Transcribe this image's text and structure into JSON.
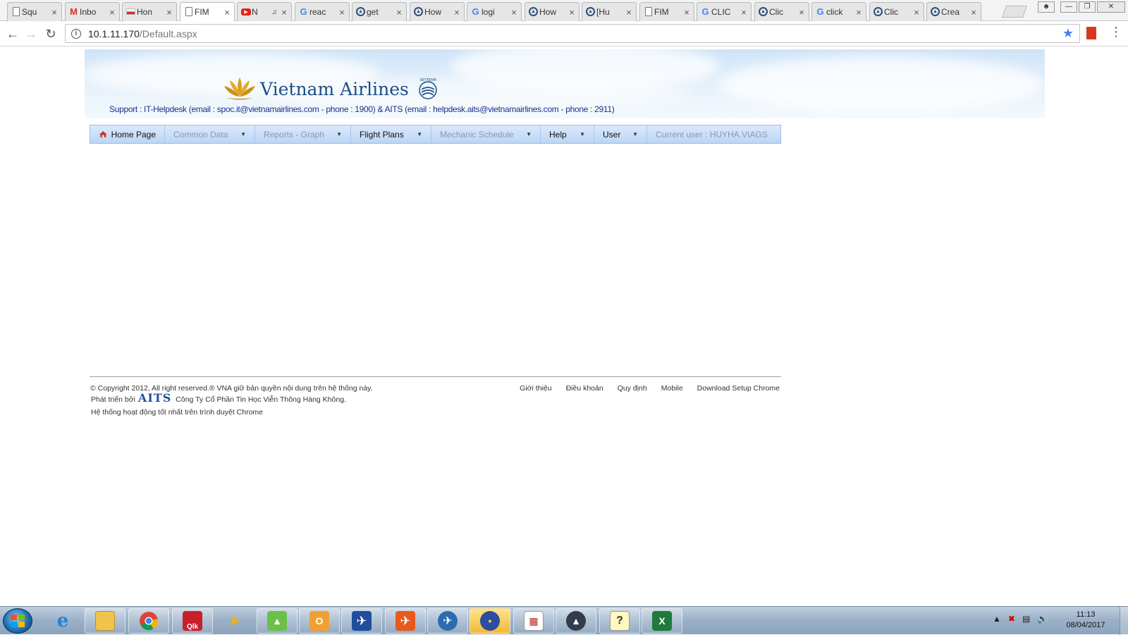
{
  "tabs": [
    {
      "title": "Squ",
      "favicon": "doc"
    },
    {
      "title": "Inbo",
      "favicon": "gmail"
    },
    {
      "title": "Hon",
      "favicon": "flag"
    },
    {
      "title": "FIM",
      "favicon": "doc",
      "active": true
    },
    {
      "title": "N",
      "favicon": "youtube",
      "audio": true
    },
    {
      "title": "reac",
      "favicon": "google"
    },
    {
      "title": "get",
      "favicon": "circle"
    },
    {
      "title": "How",
      "favicon": "circle"
    },
    {
      "title": "logi",
      "favicon": "google"
    },
    {
      "title": "How",
      "favicon": "circle"
    },
    {
      "title": "[Hu",
      "favicon": "circle"
    },
    {
      "title": "FIM",
      "favicon": "doc"
    },
    {
      "title": "CLIC",
      "favicon": "google"
    },
    {
      "title": "Clic",
      "favicon": "circle"
    },
    {
      "title": "click",
      "favicon": "google"
    },
    {
      "title": "Clic",
      "favicon": "circle"
    },
    {
      "title": "Crea",
      "favicon": "circle"
    }
  ],
  "address": {
    "host": "10.1.11.170",
    "path": "/Default.aspx"
  },
  "brand": {
    "name": "Vietnam Airlines",
    "skyteam": "SKYTEAM",
    "support": "Support : IT-Helpdesk (email : spoc.it@vietnamairlines.com - phone : 1900) & AITS (email : helpdesk.aits@vietnamairlines.com - phone : 2911)"
  },
  "menu": [
    {
      "label": "Home Page",
      "icon": "home-icon",
      "enabled": true,
      "dropdown": false
    },
    {
      "label": "Common Data",
      "enabled": false,
      "dropdown": true
    },
    {
      "label": "Reports - Graph",
      "enabled": false,
      "dropdown": true
    },
    {
      "label": "Flight Plans",
      "enabled": true,
      "dropdown": true
    },
    {
      "label": "Mechanic Schedule",
      "enabled": false,
      "dropdown": true
    },
    {
      "label": "Help",
      "enabled": true,
      "dropdown": true
    },
    {
      "label": "User",
      "enabled": true,
      "dropdown": true
    },
    {
      "label": "Current user : HUYHA.VIAGS",
      "enabled": false,
      "dropdown": false
    }
  ],
  "footer": {
    "copyright": "© Copyright 2012, All right reserved.® VNA giữ bản quyền nội dung trên hệ thống này.",
    "developed_by": "Phát triển bởi",
    "aits_logo": "AITS",
    "company": "Công Ty Cổ Phần Tin Học Viễn Thông Hàng Không.",
    "browser_note": "Hệ thống hoạt động tốt nhất trên trình duyệt Chrome",
    "links": [
      "Giới thiệu",
      "Điều khoản",
      "Quy định",
      "Mobile",
      "Download Setup Chrome"
    ]
  },
  "taskbar": {
    "apps": [
      "internet-explorer",
      "file-explorer",
      "chrome",
      "qlk",
      "paper-plane",
      "green-app",
      "outlook",
      "airplane-app",
      "orange-app",
      "navigator",
      "flight-app",
      "chart-app",
      "aircraft-app",
      "help-file",
      "excel"
    ],
    "qlk_label": "Qlk",
    "time": "11:13",
    "date": "08/04/2017"
  },
  "colors": {
    "menu_bg": "#c8dcf6",
    "brand_blue": "#1a4d88",
    "support_text": "#1a2f8a",
    "disabled_menu": "#8a98ad"
  }
}
